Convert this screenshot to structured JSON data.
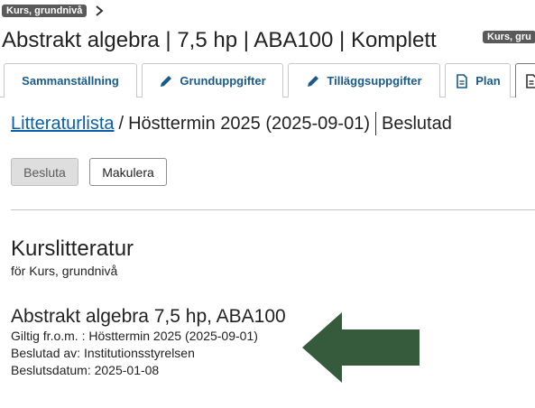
{
  "breadcrumb": {
    "badge": "Kurs, grundnivå"
  },
  "page": {
    "title": "Abstrakt algebra | 7,5 hp | ABA100 | Komplett",
    "title_badge": "Kurs, gru"
  },
  "tabs": [
    {
      "label": "Sammanställning",
      "icon": ""
    },
    {
      "label": "Grunduppgifter",
      "icon": "pencil-icon"
    },
    {
      "label": "Tilläggsuppgifter",
      "icon": "pencil-icon"
    },
    {
      "label": "Plan",
      "icon": "document-icon"
    },
    {
      "label": "",
      "icon": "document-icon"
    }
  ],
  "header": {
    "link": "Litteraturlista",
    "separator": "/",
    "term": "Hösttermin 2025 (2025-09-01)",
    "status": "Beslutad"
  },
  "actions": {
    "decide": "Besluta",
    "cancel": "Makulera"
  },
  "literature": {
    "title": "Kurslitteratur",
    "subtitle": "för Kurs, grundnivå",
    "course": "Abstrakt algebra 7,5 hp, ABA100",
    "valid_from": "Giltig fr.o.m. : Hösttermin 2025 (2025-09-01)",
    "decided_by": "Beslutad av: Institutionsstyrelsen",
    "decision_date": "Beslutsdatum: 2025-01-08"
  },
  "colors": {
    "arrow": "#355a3c",
    "link": "#0b5fa8",
    "tab_text": "#1a5a8a",
    "badge_bg": "#5a5a5a"
  },
  "annotation": {
    "icon": "left-arrow-icon"
  }
}
